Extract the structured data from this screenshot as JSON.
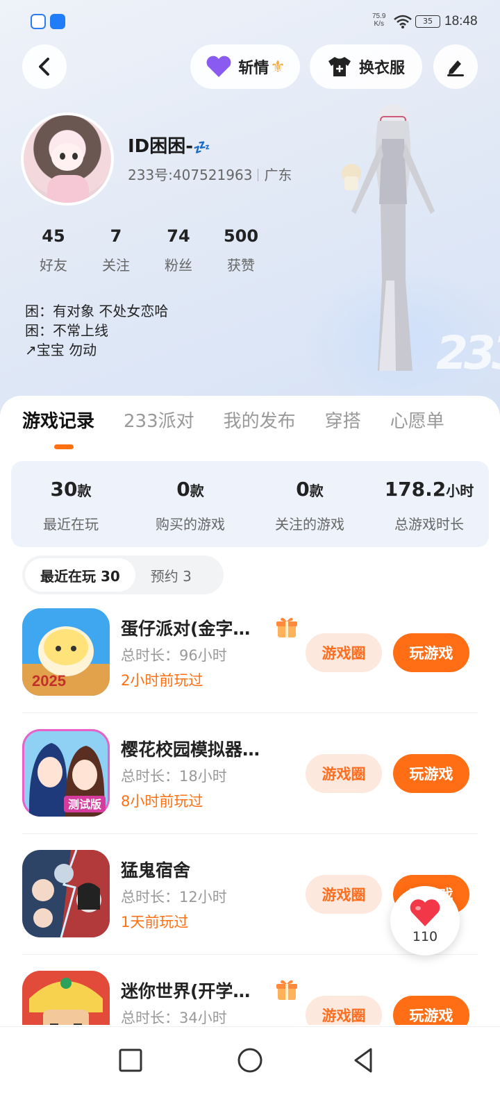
{
  "status_bar": {
    "net_speed_value": "75.9",
    "net_speed_unit": "K/s",
    "battery": "35",
    "time": "18:48"
  },
  "header": {
    "zq_label": "斩情",
    "outfit_label": "换衣服"
  },
  "profile": {
    "name": "ID困困-",
    "name_suffix": "💤",
    "uid": "233号:407521963",
    "region": "广东",
    "stats": [
      {
        "value": "45",
        "label": "好友"
      },
      {
        "value": "7",
        "label": "关注"
      },
      {
        "value": "74",
        "label": "粉丝"
      },
      {
        "value": "500",
        "label": "获赞"
      }
    ],
    "bio": [
      "困：有对象 不处女恋哈",
      "困：不常上线",
      "↗宝宝  勿动"
    ]
  },
  "tabs": [
    "游戏记录",
    "233派对",
    "我的发布",
    "穿搭",
    "心愿单"
  ],
  "active_tab": 0,
  "summary": [
    {
      "value": "30",
      "unit": "款",
      "label": "最近在玩"
    },
    {
      "value": "0",
      "unit": "款",
      "label": "购买的游戏"
    },
    {
      "value": "0",
      "unit": "款",
      "label": "关注的游戏"
    },
    {
      "value": "178.2",
      "unit": "小时",
      "label": "总游戏时长"
    }
  ],
  "segments": [
    "最近在玩 30",
    "预约 3"
  ],
  "games": [
    {
      "title": "蛋仔派对(金字…",
      "gift": true,
      "duration": "总时长：96小时",
      "last_played": "2小时前玩过",
      "circle_label": "游戏圈",
      "play_label": "玩游戏"
    },
    {
      "title": "樱花校园模拟器测…",
      "gift": false,
      "duration": "总时长：18小时",
      "last_played": "8小时前玩过",
      "circle_label": "游戏圈",
      "play_label": "玩游戏"
    },
    {
      "title": "猛鬼宿舍",
      "gift": false,
      "duration": "总时长：12小时",
      "last_played": "1天前玩过",
      "circle_label": "游戏圈",
      "play_label": "玩游戏"
    },
    {
      "title": "迷你世界(开学…",
      "gift": true,
      "duration": "总时长：34小时",
      "last_played": "",
      "circle_label": "游戏圈",
      "play_label": "玩游戏"
    }
  ],
  "like_count": "110",
  "colors": {
    "accent": "#ff6d14",
    "accent_light": "#fde8de",
    "summary_bg": "#eef3fb"
  },
  "icons": {
    "back": "chevron-left-icon",
    "zq": "purple-heart-icon",
    "outfit": "tshirt-icon",
    "edit": "pen-icon",
    "gift": "gift-icon",
    "like": "heart-icon",
    "nav": [
      "square-icon",
      "circle-icon",
      "triangle-back-icon"
    ]
  }
}
